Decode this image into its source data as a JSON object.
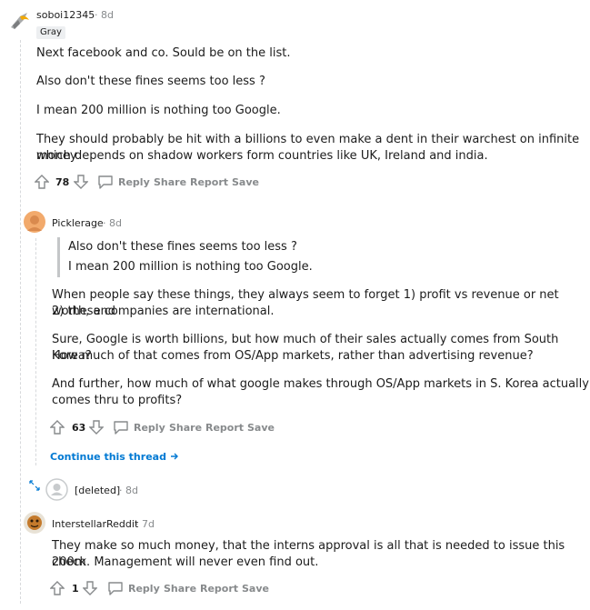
{
  "comments": [
    {
      "username": "soboi12345",
      "time": "8d",
      "flair": "Gray",
      "paragraphs": [
        "Next facebook and co. Sould be on the list.",
        "Also don't these fines seems too less ?",
        "I mean 200 million is nothing too Google.",
        "They should probably be hit with a billions to even make a dent in their warchest on infinite money",
        "which depends on shadow workers form countries like UK, Ireland and india."
      ],
      "score": "78"
    },
    {
      "username": "Picklerage",
      "time": "8d",
      "quote": [
        "Also don't these fines seems too less ?",
        "I mean 200 million is nothing too Google."
      ],
      "paragraphs": [
        "When people say these things, they always seem to forget 1) profit vs revenue or net worth, and",
        "2) these companies are international.",
        "Sure, Google is worth billions, but how much of their sales actually comes from South Korea?",
        "How much of that comes from OS/App markets, rather than advertising revenue?",
        "And further, how much of what google makes through OS/App markets in S. Korea actually",
        "comes thru to profits?"
      ],
      "score": "63",
      "continue_label": "Continue this thread"
    },
    {
      "username": "[deleted]",
      "time": "8d"
    },
    {
      "username": "InterstellarReddit",
      "time": "7d",
      "paragraphs": [
        "They make so much money, that the interns approval is all that is needed to issue this 200m",
        "check. Management will never even find out."
      ],
      "score": "1"
    }
  ],
  "actions": {
    "reply": "Reply",
    "share": "Share",
    "report": "Report",
    "save": "Save"
  },
  "separator": "·",
  "colors": {
    "meta": "#878a8c",
    "link": "#0079d3",
    "thread_line": "#d7d9dc"
  }
}
